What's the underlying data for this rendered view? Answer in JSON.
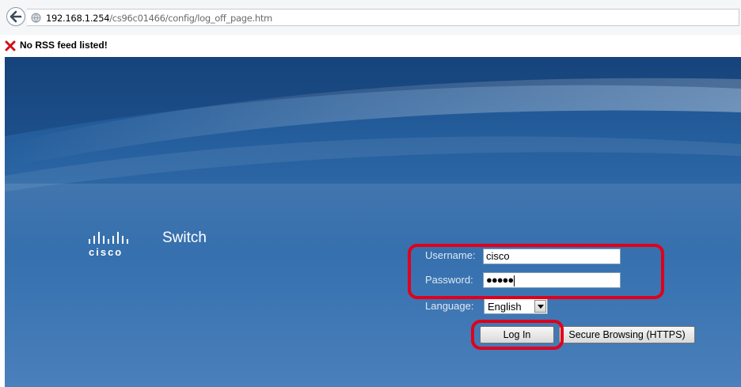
{
  "browser": {
    "url_host": "192.168.1.254",
    "url_path": "/cs96c01466/config/log_off_page.htm"
  },
  "rss": {
    "message": "No RSS feed listed!"
  },
  "login": {
    "brand_name": "cisco",
    "product_name": "Switch",
    "username_label": "Username:",
    "username_value": "cisco",
    "password_label": "Password:",
    "password_mask": "●●●●●",
    "language_label": "Language:",
    "language_selected": "English",
    "login_button": "Log In",
    "secure_button": "Secure Browsing (HTTPS)"
  },
  "colors": {
    "highlight": "#e0001b",
    "page_blue": "#2f6aa9"
  }
}
